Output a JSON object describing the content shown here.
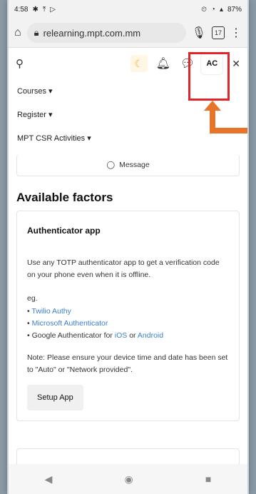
{
  "status_bar": {
    "time": "4:58",
    "battery": "87%"
  },
  "browser": {
    "url": "relearning.mpt.com.mm",
    "tab_count": "17"
  },
  "topnav": {
    "avatar_initials": "AC"
  },
  "menu": {
    "items": [
      {
        "label": "Courses"
      },
      {
        "label": "Register"
      },
      {
        "label": "MPT CSR Activities"
      }
    ]
  },
  "message": {
    "label": "Message"
  },
  "main": {
    "section_title": "Available factors",
    "factor": {
      "title": "Authenticator app",
      "description": "Use any TOTP authenticator app to get a verification code on your phone even when it is offline.",
      "eg_label": "eg.",
      "apps": [
        {
          "name": "Twilio Authy"
        },
        {
          "name": "Microsoft Authenticator"
        }
      ],
      "google": {
        "prefix": "Google Authenticator for",
        "ios": "iOS",
        "or": "or",
        "android": "Android"
      },
      "note": "Note: Please ensure your device time and date has been set to \"Auto\" or \"Network provided\".",
      "setup_button": "Setup App"
    }
  },
  "colors": {
    "highlight": "#e0262b",
    "arrow": "#e8742a",
    "link": "#3b7fd1"
  }
}
